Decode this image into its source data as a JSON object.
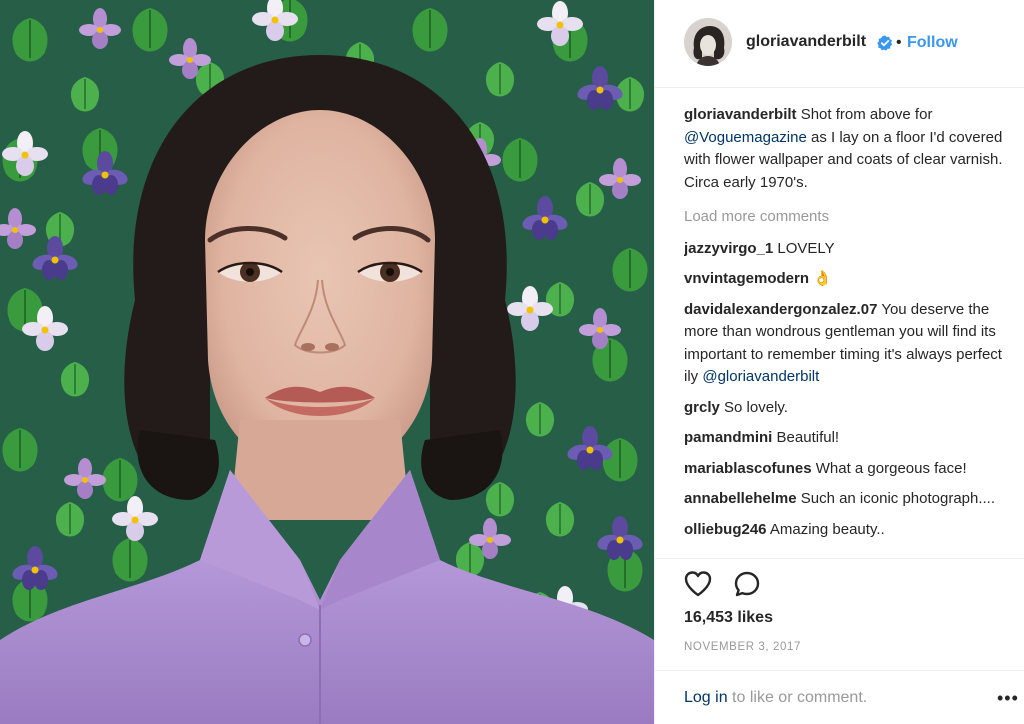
{
  "post": {
    "username": "gloriavanderbilt",
    "dot": "•",
    "follow_label": "Follow",
    "caption_text": "Shot from above for",
    "caption_mention": "@Voguemagazine",
    "caption_rest": "as I lay on a floor I'd covered with flower wallpaper and coats of clear varnish. Circa early 1970's.",
    "load_more": "Load more comments",
    "likes": "16,453 likes",
    "date": "NOVEMBER 3, 2017",
    "login_link": "Log in",
    "login_text": "to like or comment.",
    "more_label": "•••"
  },
  "comments": [
    {
      "user": "jazzyvirgo_1",
      "text": "LOVELY"
    },
    {
      "user": "vnvintagemodern",
      "text": "👌"
    },
    {
      "user": "davidalexandergonzalez.07",
      "text": "You deserve the more than wondrous gentleman you will find its important to remember timing it's always perfect ily",
      "mention": "@gloriavanderbilt"
    },
    {
      "user": "grcly",
      "text": "So lovely."
    },
    {
      "user": "pamandmini",
      "text": "Beautiful!"
    },
    {
      "user": "mariablascofunes",
      "text": "What a gorgeous face!"
    },
    {
      "user": "annabellehelme",
      "text": "Such an iconic photograph...."
    },
    {
      "user": "olliebug246",
      "text": "Amazing beauty.."
    }
  ],
  "icons": {
    "heart": "heart-icon",
    "comment": "comment-icon",
    "verified": "verified-badge-icon",
    "more": "more-options-icon"
  },
  "colors": {
    "link_blue": "#3897f0",
    "mention_navy": "#003569",
    "muted_gray": "#999999",
    "text_dark": "#262626",
    "wallpaper_green": "#2e8b3a",
    "violet": "#5b4a9e",
    "shirt_lilac": "#b295d6"
  }
}
